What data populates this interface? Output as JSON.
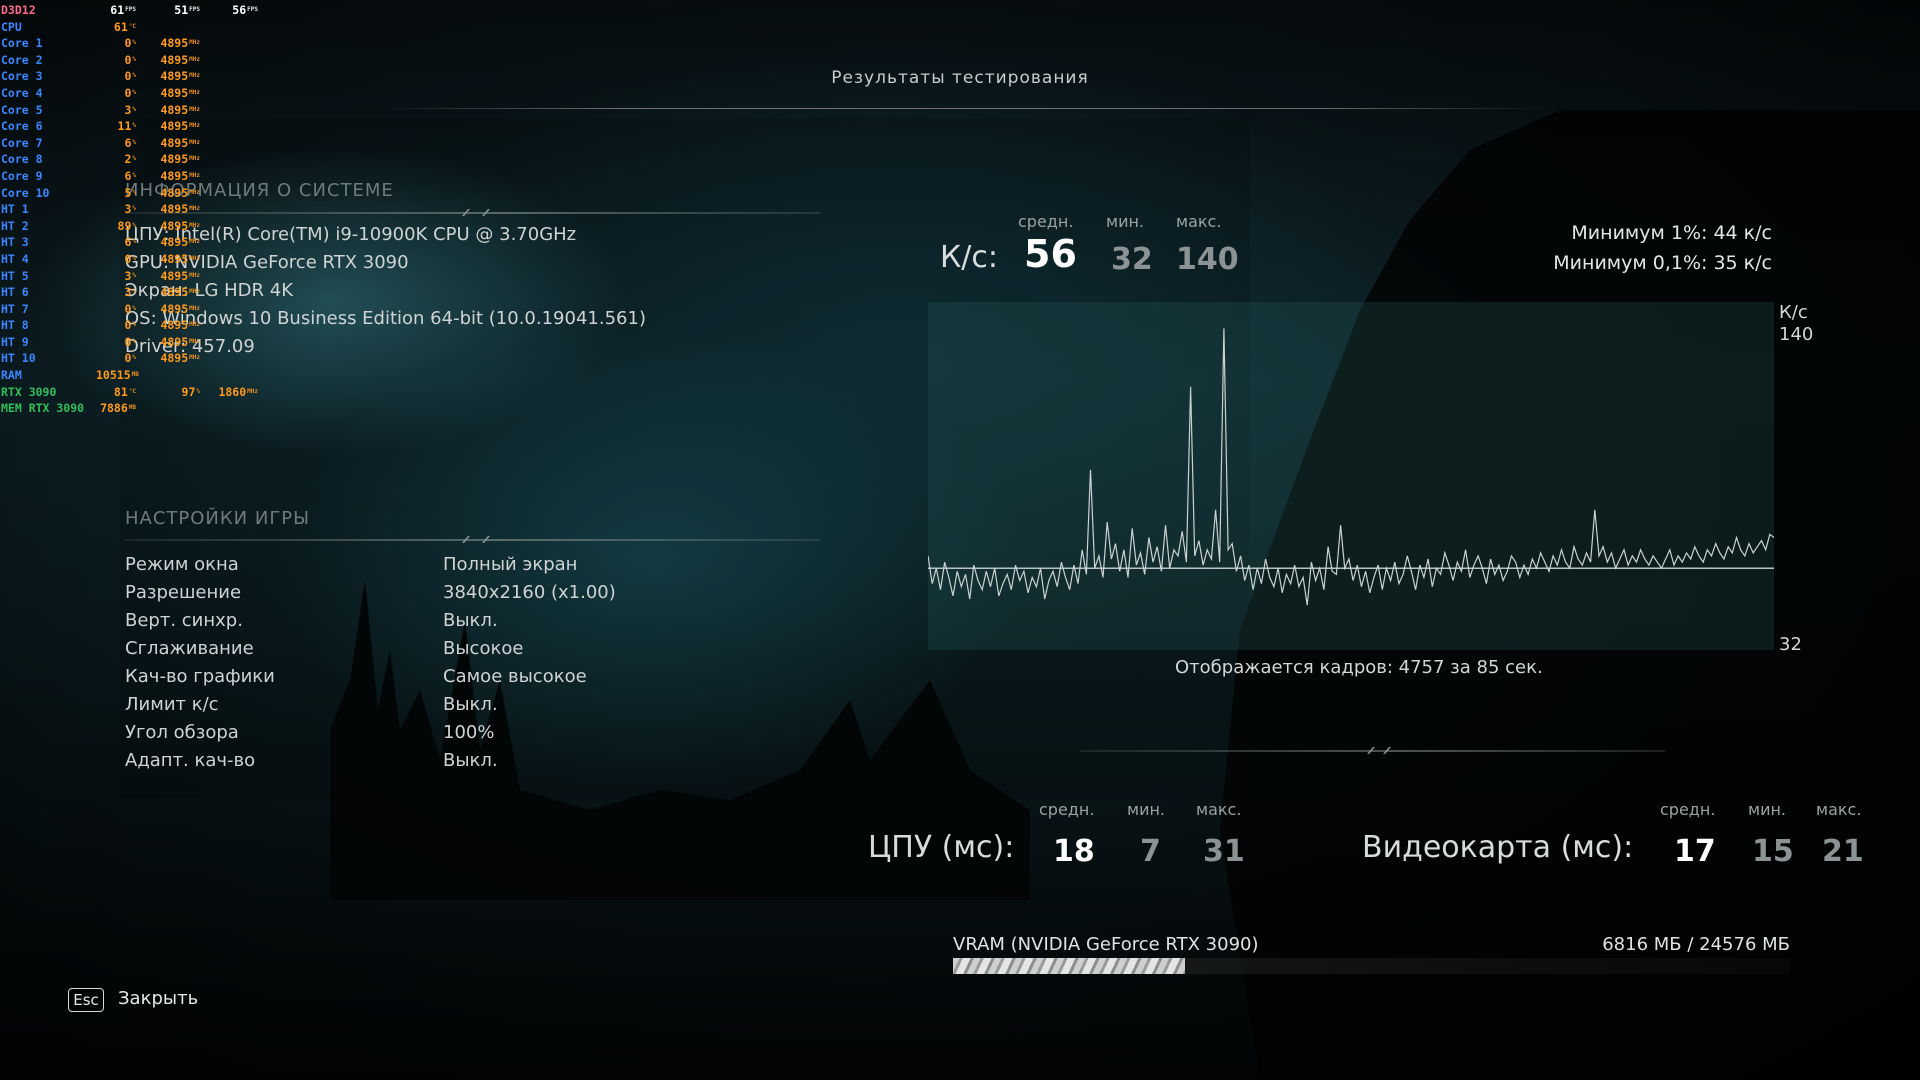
{
  "osd": {
    "rows": [
      {
        "label": "D3D12",
        "cls": "pink",
        "v1": "61",
        "u1": "FPS",
        "c1": "wh",
        "v2": "51",
        "u2": "FPS",
        "c2": "wh",
        "v3": "56",
        "u3": "FPS",
        "c3": ""
      },
      {
        "label": "CPU",
        "cls": "",
        "v1": "61",
        "u1": "°C",
        "c1": "",
        "v2": "",
        "u2": "",
        "c2": "",
        "v3": "",
        "u3": "",
        "c3": ""
      },
      {
        "label": "Core 1",
        "cls": "",
        "v1": "0",
        "u1": "%",
        "c1": "",
        "v2": "4895",
        "u2": "MHz",
        "c2": "",
        "v3": "",
        "u3": "",
        "c3": ""
      },
      {
        "label": "Core 2",
        "cls": "",
        "v1": "0",
        "u1": "%",
        "c1": "",
        "v2": "4895",
        "u2": "MHz",
        "c2": "",
        "v3": "",
        "u3": "",
        "c3": ""
      },
      {
        "label": "Core 3",
        "cls": "",
        "v1": "0",
        "u1": "%",
        "c1": "",
        "v2": "4895",
        "u2": "MHz",
        "c2": "",
        "v3": "",
        "u3": "",
        "c3": ""
      },
      {
        "label": "Core 4",
        "cls": "",
        "v1": "0",
        "u1": "%",
        "c1": "",
        "v2": "4895",
        "u2": "MHz",
        "c2": "",
        "v3": "",
        "u3": "",
        "c3": ""
      },
      {
        "label": "Core 5",
        "cls": "",
        "v1": "3",
        "u1": "%",
        "c1": "",
        "v2": "4895",
        "u2": "MHz",
        "c2": "",
        "v3": "",
        "u3": "",
        "c3": ""
      },
      {
        "label": "Core 6",
        "cls": "",
        "v1": "11",
        "u1": "%",
        "c1": "",
        "v2": "4895",
        "u2": "MHz",
        "c2": "",
        "v3": "",
        "u3": "",
        "c3": ""
      },
      {
        "label": "Core 7",
        "cls": "",
        "v1": "6",
        "u1": "%",
        "c1": "",
        "v2": "4895",
        "u2": "MHz",
        "c2": "",
        "v3": "",
        "u3": "",
        "c3": ""
      },
      {
        "label": "Core 8",
        "cls": "",
        "v1": "2",
        "u1": "%",
        "c1": "",
        "v2": "4895",
        "u2": "MHz",
        "c2": "",
        "v3": "",
        "u3": "",
        "c3": ""
      },
      {
        "label": "Core 9",
        "cls": "",
        "v1": "6",
        "u1": "%",
        "c1": "",
        "v2": "4895",
        "u2": "MHz",
        "c2": "",
        "v3": "",
        "u3": "",
        "c3": ""
      },
      {
        "label": "Core 10",
        "cls": "",
        "v1": "5",
        "u1": "%",
        "c1": "",
        "v2": "4895",
        "u2": "MHz",
        "c2": "",
        "v3": "",
        "u3": "",
        "c3": ""
      },
      {
        "label": "HT 1",
        "cls": "",
        "v1": "3",
        "u1": "%",
        "c1": "",
        "v2": "4895",
        "u2": "MHz",
        "c2": "",
        "v3": "",
        "u3": "",
        "c3": ""
      },
      {
        "label": "HT 2",
        "cls": "",
        "v1": "89",
        "u1": "%",
        "c1": "",
        "v2": "4895",
        "u2": "MHz",
        "c2": "",
        "v3": "",
        "u3": "",
        "c3": ""
      },
      {
        "label": "HT 3",
        "cls": "",
        "v1": "6",
        "u1": "%",
        "c1": "",
        "v2": "4895",
        "u2": "MHz",
        "c2": "",
        "v3": "",
        "u3": "",
        "c3": ""
      },
      {
        "label": "HT 4",
        "cls": "",
        "v1": "0",
        "u1": "%",
        "c1": "",
        "v2": "4895",
        "u2": "MHz",
        "c2": "",
        "v3": "",
        "u3": "",
        "c3": ""
      },
      {
        "label": "HT 5",
        "cls": "",
        "v1": "3",
        "u1": "%",
        "c1": "",
        "v2": "4895",
        "u2": "MHz",
        "c2": "",
        "v3": "",
        "u3": "",
        "c3": ""
      },
      {
        "label": "HT 6",
        "cls": "",
        "v1": "3",
        "u1": "%",
        "c1": "",
        "v2": "4895",
        "u2": "MHz",
        "c2": "",
        "v3": "",
        "u3": "",
        "c3": ""
      },
      {
        "label": "HT 7",
        "cls": "",
        "v1": "0",
        "u1": "%",
        "c1": "",
        "v2": "4895",
        "u2": "MHz",
        "c2": "",
        "v3": "",
        "u3": "",
        "c3": ""
      },
      {
        "label": "HT 8",
        "cls": "",
        "v1": "0",
        "u1": "%",
        "c1": "",
        "v2": "4895",
        "u2": "MHz",
        "c2": "",
        "v3": "",
        "u3": "",
        "c3": ""
      },
      {
        "label": "HT 9",
        "cls": "",
        "v1": "0",
        "u1": "%",
        "c1": "",
        "v2": "4895",
        "u2": "MHz",
        "c2": "",
        "v3": "",
        "u3": "",
        "c3": ""
      },
      {
        "label": "HT 10",
        "cls": "",
        "v1": "0",
        "u1": "%",
        "c1": "",
        "v2": "4895",
        "u2": "MHz",
        "c2": "",
        "v3": "",
        "u3": "",
        "c3": ""
      },
      {
        "label": "RAM",
        "cls": "",
        "v1": "10515",
        "u1": "MB",
        "c1": "",
        "v2": "",
        "u2": "",
        "c2": "",
        "v3": "",
        "u3": "",
        "c3": ""
      },
      {
        "label": "RTX 3090",
        "cls": "green",
        "v1": "81",
        "u1": "°C",
        "c1": "",
        "v2": "97",
        "u2": "%",
        "c2": "",
        "v3": "1860",
        "u3": "MHz",
        "c3": "or"
      },
      {
        "label": "MEM RTX 3090",
        "cls": "green",
        "v1": "7886",
        "u1": "MB",
        "c1": "",
        "v2": "",
        "u2": "",
        "c2": "",
        "v3": "",
        "u3": "",
        "c3": ""
      }
    ]
  },
  "title": "Результаты тестирования",
  "system": {
    "heading": "ИНФОРМАЦИЯ О СИСТЕМЕ",
    "lines": [
      "ЦПУ: Intel(R) Core(TM) i9-10900K CPU @ 3.70GHz",
      "GPU: NVIDIA GeForce RTX 3090",
      "Экран: LG HDR 4K",
      "OS: Windows 10 Business Edition 64-bit (10.0.19041.561)",
      "Driver: 457.09"
    ]
  },
  "settings": {
    "heading": "НАСТРОЙКИ ИГРЫ",
    "rows": [
      {
        "k": "Режим окна",
        "v": "Полный экран"
      },
      {
        "k": "Разрешение",
        "v": "3840x2160 (x1.00)"
      },
      {
        "k": "Верт. синхр.",
        "v": "Выкл."
      },
      {
        "k": "Сглаживание",
        "v": "Высокое"
      },
      {
        "k": "Кач-во графики",
        "v": "Самое высокое"
      },
      {
        "k": "Лимит к/с",
        "v": "Выкл."
      },
      {
        "k": "Угол обзора",
        "v": "100%"
      },
      {
        "k": "Адапт. кач-во",
        "v": "Выкл."
      }
    ]
  },
  "fps": {
    "label": "К/с:",
    "avg_h": "средн.",
    "min_h": "мин.",
    "max_h": "макс.",
    "avg": "56",
    "min": "32",
    "max": "140",
    "low1": "Минимум 1%: 44 к/с",
    "low01": "Минимум 0,1%: 35 к/с"
  },
  "chart_data": {
    "type": "line",
    "ylabel": "К/с",
    "ylim": [
      32,
      140
    ],
    "yticks": [
      "140",
      "32"
    ],
    "avg_line": 56,
    "series": [
      {
        "values": [
          60,
          51,
          56,
          49,
          58,
          53,
          47,
          55,
          50,
          54,
          46,
          57,
          52,
          49,
          55,
          50,
          56,
          47,
          51,
          54,
          49,
          57,
          52,
          55,
          48,
          53,
          50,
          56,
          46,
          52,
          55,
          50,
          58,
          53,
          49,
          57,
          51,
          62,
          54,
          88,
          56,
          60,
          53,
          71,
          59,
          64,
          55,
          62,
          53,
          69,
          57,
          61,
          54,
          66,
          58,
          63,
          55,
          70,
          56,
          62,
          60,
          68,
          58,
          115,
          60,
          65,
          57,
          62,
          59,
          75,
          58,
          134,
          62,
          64,
          55,
          60,
          52,
          57,
          49,
          56,
          51,
          59,
          53,
          50,
          56,
          48,
          54,
          51,
          57,
          50,
          53,
          44,
          58,
          52,
          56,
          49,
          63,
          55,
          54,
          70,
          56,
          59,
          52,
          57,
          50,
          55,
          48,
          53,
          57,
          49,
          56,
          52,
          58,
          51,
          54,
          60,
          55,
          49,
          57,
          53,
          59,
          50,
          56,
          54,
          61,
          57,
          52,
          58,
          55,
          62,
          53,
          57,
          60,
          56,
          51,
          59,
          54,
          57,
          52,
          55,
          60,
          58,
          53,
          57,
          54,
          59,
          56,
          61,
          58,
          55,
          60,
          57,
          62,
          58,
          56,
          63,
          59,
          57,
          61,
          58,
          75,
          60,
          63,
          58,
          61,
          56,
          59,
          62,
          57,
          60,
          58,
          62,
          59,
          57,
          60,
          58,
          56,
          59,
          62,
          57,
          60,
          58,
          61,
          59,
          63,
          60,
          58,
          62,
          60,
          64,
          61,
          59,
          63,
          61,
          66,
          62,
          60,
          64,
          61,
          63,
          65,
          62,
          67,
          66
        ]
      }
    ]
  },
  "frames_text": "Отображается кадров: 4757 за 85 сек.",
  "cpu": {
    "label": "ЦПУ (мс):",
    "avg_h": "средн.",
    "min_h": "мин.",
    "max_h": "макс.",
    "avg": "18",
    "min": "7",
    "max": "31"
  },
  "gpu": {
    "label": "Видеокарта (мс):",
    "avg_h": "средн.",
    "min_h": "мин.",
    "max_h": "макс.",
    "avg": "17",
    "min": "15",
    "max": "21"
  },
  "vram": {
    "label": "VRAM (NVIDIA GeForce RTX 3090)",
    "value": "6816 МБ / 24576 МБ",
    "used": 6816,
    "total": 24576
  },
  "footer": {
    "key": "Esc",
    "action": "Закрыть"
  }
}
